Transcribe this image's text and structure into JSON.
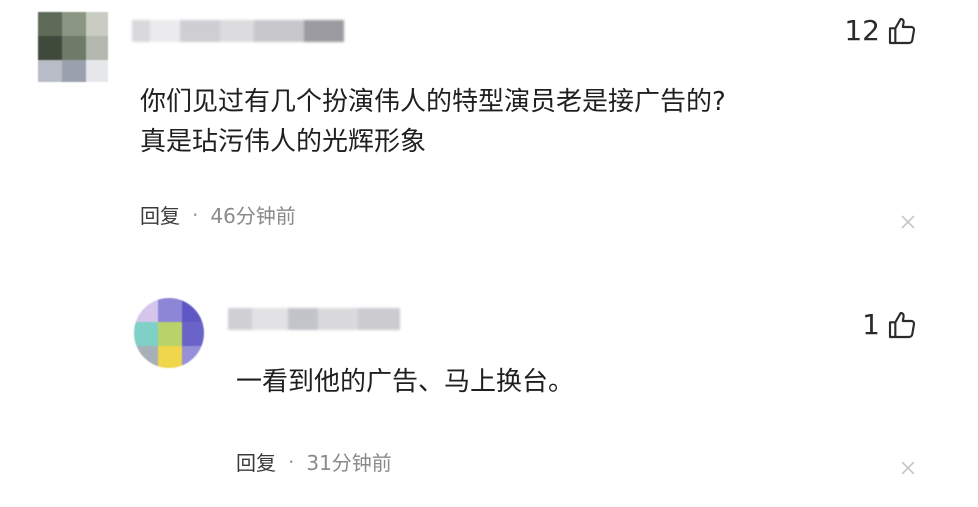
{
  "comments": [
    {
      "like_count": "12",
      "text": "你们见过有几个扮演伟人的特型演员老是接广告的?\n真是玷污伟人的光辉形象",
      "reply_label": "回复",
      "separator": "·",
      "time": "46分钟前"
    },
    {
      "like_count": "1",
      "text": "一看到他的广告、马上换台。",
      "reply_label": "回复",
      "separator": "·",
      "time": "31分钟前"
    }
  ],
  "icons": {
    "like": "thumbs-up-icon",
    "close": "close-icon"
  },
  "colors": {
    "text": "#1f1f1f",
    "meta": "#8a8a8a",
    "close": "#c8c8c8"
  }
}
